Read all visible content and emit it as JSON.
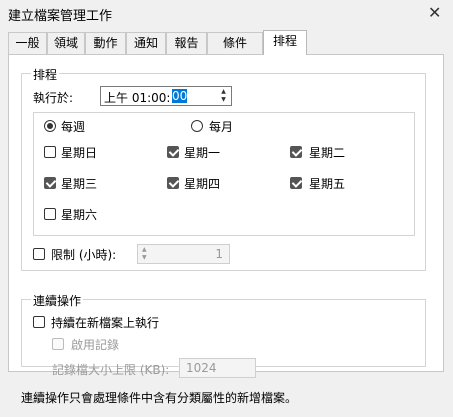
{
  "window": {
    "title": "建立檔案管理工作",
    "close_glyph": "✕"
  },
  "tabs": [
    "一般",
    "領域",
    "動作",
    "通知",
    "報告",
    "條件",
    "排程"
  ],
  "schedule": {
    "group_label": "排程",
    "run_at_label": "執行於:",
    "time": {
      "prefix": "上午 01:00:",
      "selected": "00"
    },
    "frequency": [
      {
        "label": "每週",
        "checked": true
      },
      {
        "label": "每月",
        "checked": false
      }
    ],
    "days": [
      {
        "label": "星期日",
        "checked": false
      },
      {
        "label": "星期一",
        "checked": true
      },
      {
        "label": "星期二",
        "checked": true
      },
      {
        "label": "星期三",
        "checked": true
      },
      {
        "label": "星期四",
        "checked": true
      },
      {
        "label": "星期五",
        "checked": true
      },
      {
        "label": "星期六",
        "checked": false
      }
    ],
    "limit": {
      "label": "限制 (小時):",
      "checked": false,
      "value": "1"
    }
  },
  "continuous": {
    "group_label": "連續操作",
    "run_on_new_label": "持續在新檔案上執行",
    "run_on_new_checked": false,
    "enable_log_label": "啟用記錄",
    "log_size_label": "記錄檔大小上限 (KB):",
    "log_size_value": "1024"
  },
  "footer_note": "連續操作只會處理條件中含有分類屬性的新增檔案。"
}
